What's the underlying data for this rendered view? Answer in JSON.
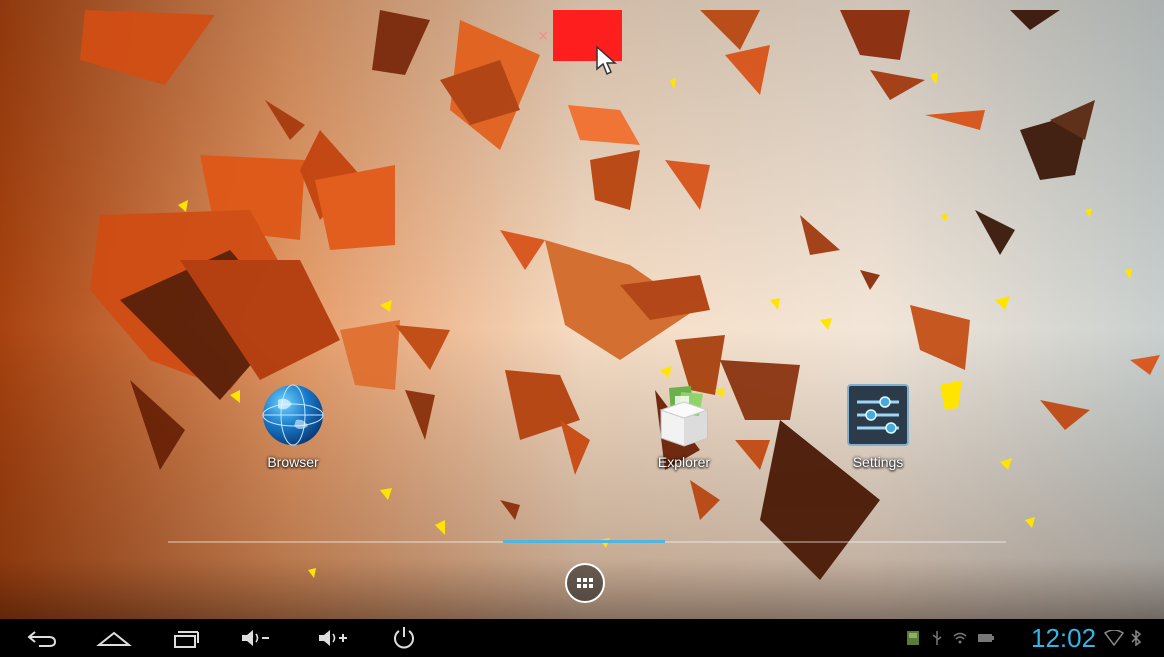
{
  "wallpaper": {
    "description_colors": [
      "#c85a17",
      "#f0c7a0",
      "#ffe600"
    ]
  },
  "desktop": {
    "apps": [
      {
        "label": "Browser",
        "icon": "globe-icon"
      },
      {
        "label": "Explorer",
        "icon": "box-icon"
      },
      {
        "label": "Settings",
        "icon": "sliders-icon"
      }
    ],
    "page_indicator": {
      "pages": 5,
      "current": 3
    },
    "all_apps_icon": "grid-icon"
  },
  "navbar": {
    "buttons": [
      {
        "name": "back",
        "icon": "back-arrow-icon"
      },
      {
        "name": "home",
        "icon": "home-icon"
      },
      {
        "name": "recent",
        "icon": "recent-apps-icon"
      },
      {
        "name": "volume-down",
        "icon": "volume-down-icon"
      },
      {
        "name": "volume-up",
        "icon": "volume-up-icon"
      },
      {
        "name": "power",
        "icon": "power-icon"
      }
    ]
  },
  "status": {
    "clock": "12:02",
    "icons": [
      "sd-card-icon",
      "usb-icon",
      "wifi-icon",
      "battery-icon",
      "wifi-signal-icon",
      "bluetooth-icon"
    ],
    "clock_color": "#33b5e5"
  },
  "drag": {
    "remove_target_color": "#ff1e1e",
    "cursor": "cursor-icon"
  }
}
